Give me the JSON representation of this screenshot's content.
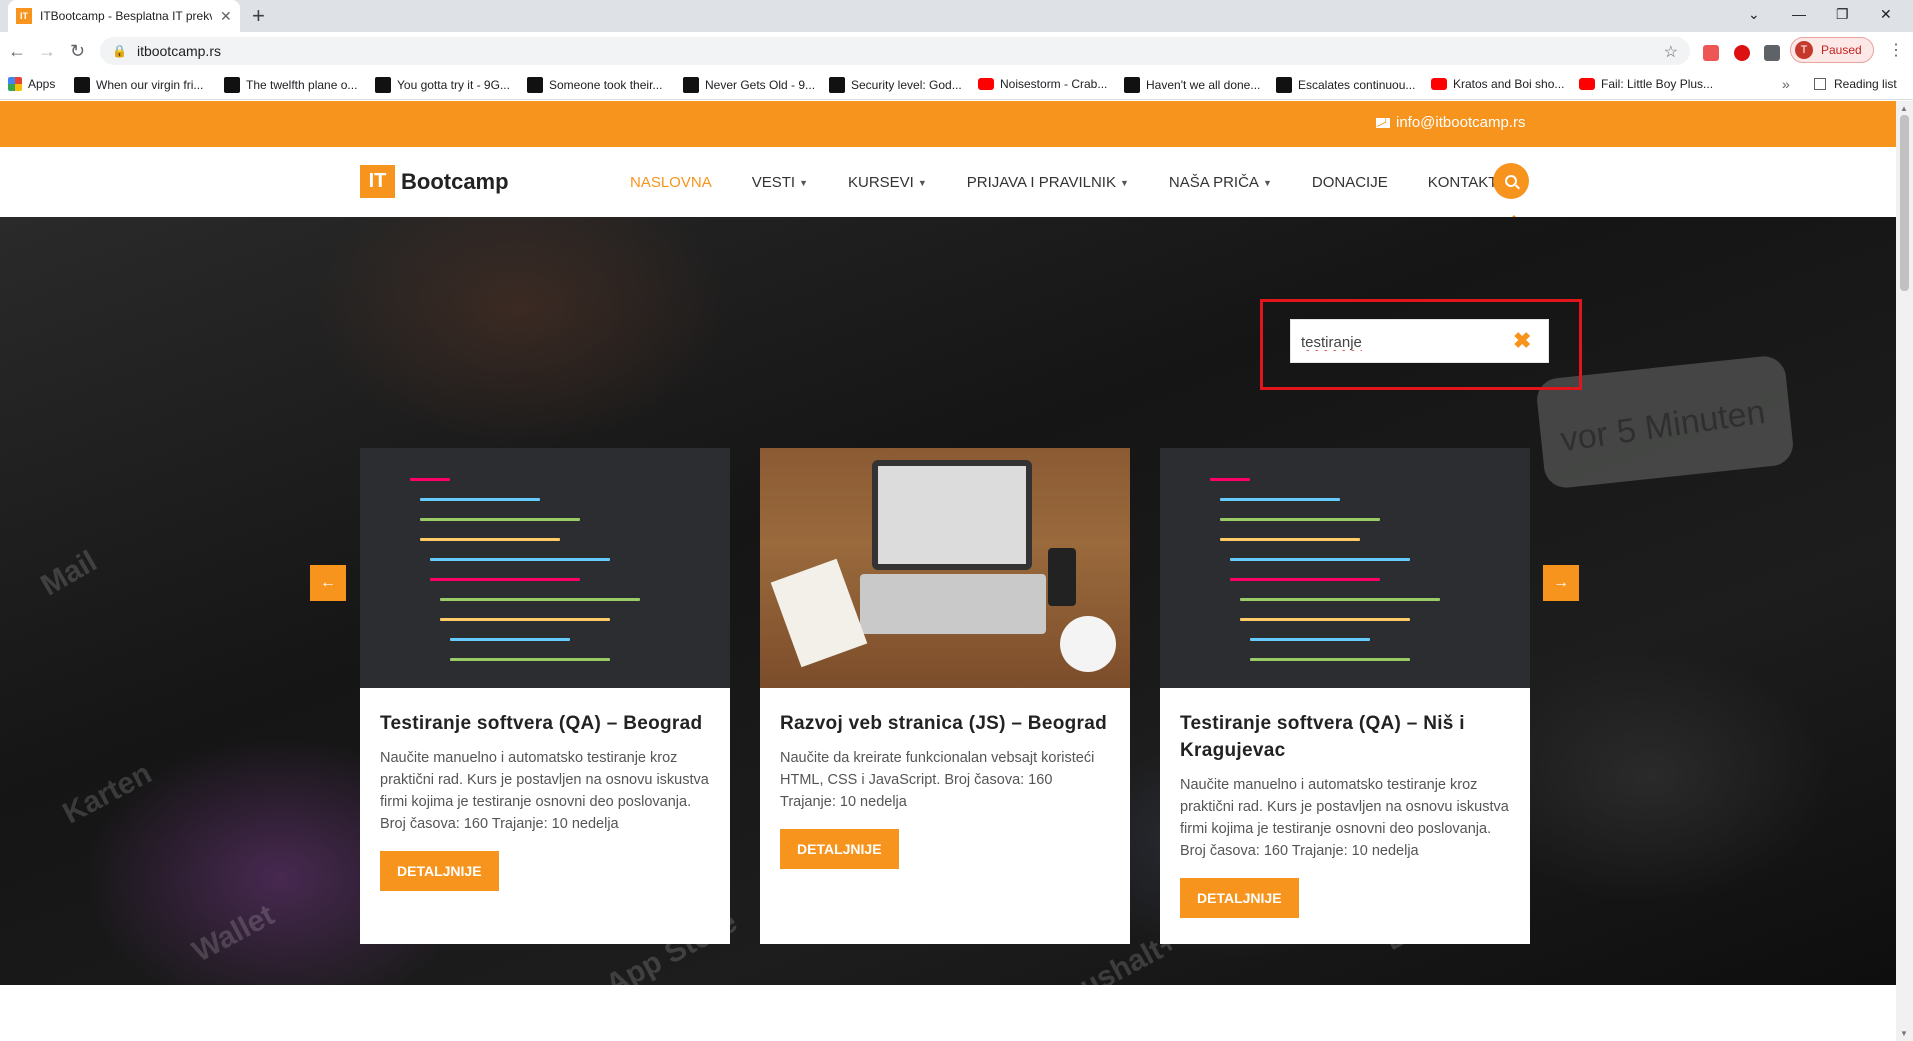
{
  "browser": {
    "tab_title": "ITBootcamp - Besplatna IT prekv",
    "tab_favicon": "IT",
    "url": "itbootcamp.rs",
    "profile_initial": "T",
    "profile_status": "Paused",
    "bookmarks": [
      {
        "label": "Apps",
        "icon": "apps-icon"
      },
      {
        "label": "When our virgin fri...",
        "icon": "9gag-icon"
      },
      {
        "label": "The twelfth plane o...",
        "icon": "9gag-icon"
      },
      {
        "label": "You gotta try it - 9G...",
        "icon": "9gag-icon"
      },
      {
        "label": "Someone took their...",
        "icon": "9gag-icon"
      },
      {
        "label": "Never Gets Old - 9...",
        "icon": "9gag-icon"
      },
      {
        "label": "Security level: God...",
        "icon": "9gag-icon"
      },
      {
        "label": "Noisestorm - Crab...",
        "icon": "youtube-icon"
      },
      {
        "label": "Haven't we all done...",
        "icon": "9gag-icon"
      },
      {
        "label": "Escalates continuou...",
        "icon": "9gag-icon"
      },
      {
        "label": "Kratos and Boi sho...",
        "icon": "youtube-icon"
      },
      {
        "label": "Fail: Little Boy Plus...",
        "icon": "youtube-icon"
      }
    ],
    "reading_list": "Reading list"
  },
  "site": {
    "email": "info@itbootcamp.rs",
    "logo_box": "IT",
    "logo_text": "Bootcamp",
    "menu": [
      {
        "label": "NASLOVNA",
        "active": true,
        "dropdown": false
      },
      {
        "label": "VESTI",
        "active": false,
        "dropdown": true
      },
      {
        "label": "KURSEVI",
        "active": false,
        "dropdown": true
      },
      {
        "label": "PRIJAVA I PRAVILNIK",
        "active": false,
        "dropdown": true
      },
      {
        "label": "NAŠA PRIČA",
        "active": false,
        "dropdown": true
      },
      {
        "label": "DONACIJE",
        "active": false,
        "dropdown": false
      },
      {
        "label": "KONTAKT",
        "active": false,
        "dropdown": false
      }
    ],
    "search": {
      "value": "testiranje"
    },
    "hero_text": "vor 5 Minuten",
    "cards": [
      {
        "title": "Testiranje softvera (QA) – Beograd",
        "desc": "Naučite manuelno i automatsko testiranje kroz praktični rad. Kurs je postavljen na osnovu iskustva firmi kojima je testiranje osnovni deo poslovanja. Broj časova: 160 Trajanje: 10 nedelja",
        "button": "DETALJNIJE",
        "image": "code"
      },
      {
        "title": "Razvoj veb stranica (JS) – Beograd",
        "desc": "Naučite da kreirate funkcionalan vebsajt koristeći HTML, CSS i JavaScript. Broj časova: 160 Trajanje: 10 nedelja",
        "button": "DETALJNIJE",
        "image": "laptop"
      },
      {
        "title": "Testiranje softvera (QA) – Niš i Kragujevac",
        "desc": "Naučite manuelno i automatsko testiranje kroz praktični rad. Kurs je postavljen na osnovu iskustva firmi kojima je testiranje osnovni deo poslovanja. Broj časova: 160 Trajanje: 10 nedelja",
        "button": "DETALJNIJE",
        "image": "code"
      }
    ]
  },
  "colors": {
    "accent": "#f7941d",
    "highlight": "#e0161c"
  }
}
